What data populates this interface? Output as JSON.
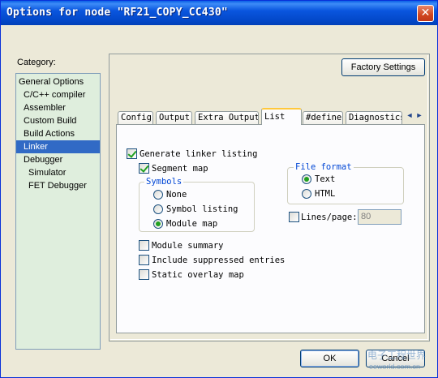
{
  "window": {
    "title": "Options for node \"RF21_COPY_CC430\""
  },
  "titlebar_close_glyph": "✕",
  "category": {
    "label": "Category:",
    "items": [
      {
        "label": "General Options",
        "indent": 0
      },
      {
        "label": "C/C++ compiler",
        "indent": 1
      },
      {
        "label": "Assembler",
        "indent": 1
      },
      {
        "label": "Custom Build",
        "indent": 1
      },
      {
        "label": "Build Actions",
        "indent": 1
      },
      {
        "label": "Linker",
        "indent": 1,
        "selected": true
      },
      {
        "label": "Debugger",
        "indent": 1
      },
      {
        "label": "Simulator",
        "indent": 2
      },
      {
        "label": "FET Debugger",
        "indent": 2
      }
    ]
  },
  "factory_settings_label": "Factory Settings",
  "tabs": [
    {
      "label": "Config"
    },
    {
      "label": "Output"
    },
    {
      "label": "Extra Output"
    },
    {
      "label": "List",
      "active": true
    },
    {
      "label": "#define"
    },
    {
      "label": "Diagnostics"
    }
  ],
  "tab_scroll": {
    "left": "◄",
    "right": "►"
  },
  "list_tab": {
    "generate_listing": {
      "label": "Generate linker listing",
      "checked": true
    },
    "segment_map": {
      "label": "Segment map",
      "checked": true
    },
    "symbols": {
      "title": "Symbols",
      "options": [
        {
          "label": "None",
          "selected": false
        },
        {
          "label": "Symbol listing",
          "selected": false
        },
        {
          "label": "Module map",
          "selected": true
        }
      ]
    },
    "file_format": {
      "title": "File format",
      "options": [
        {
          "label": "Text",
          "selected": true
        },
        {
          "label": "HTML",
          "selected": false
        }
      ]
    },
    "lines_per_page": {
      "label": "Lines/page:",
      "checked": false,
      "value": "80"
    },
    "module_summary": {
      "label": "Module summary",
      "checked": false
    },
    "include_suppressed": {
      "label": "Include suppressed entries",
      "checked": false
    },
    "static_overlay": {
      "label": "Static overlay map",
      "checked": false
    }
  },
  "buttons": {
    "ok": "OK",
    "cancel": "Cancel"
  },
  "watermark": {
    "line1": "电子工程世界",
    "line2": "eeworld.com.cn"
  }
}
